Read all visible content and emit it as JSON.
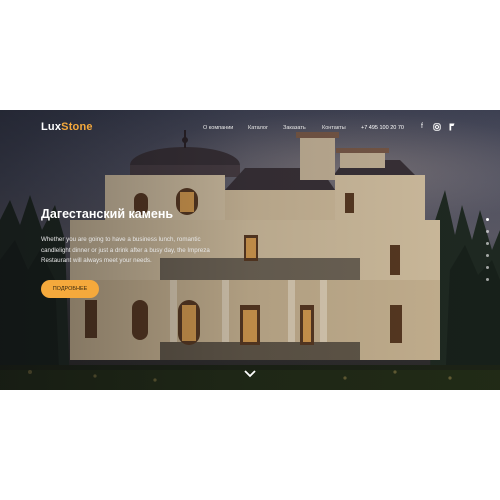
{
  "logo": {
    "part1": "Lux",
    "part2": "Stone"
  },
  "nav": {
    "links": [
      "О компании",
      "Каталог",
      "Заказать",
      "Контакты"
    ],
    "phone": "+7 495 100 20 70"
  },
  "social": {
    "icons": [
      "facebook-icon",
      "instagram-icon",
      "foursquare-icon"
    ],
    "glyphs": [
      "f",
      "◘",
      "ƒ"
    ]
  },
  "hero": {
    "title": "Дагестанский камень",
    "description": "Whether you are going to have a business lunch, romantic candlelight dinner or just a drink after a busy day, the Impreza Restaurant will always meet your needs.",
    "button_label": "ПОДРОБНЕЕ"
  },
  "slider": {
    "count": 6,
    "active_index": 0
  },
  "colors": {
    "accent": "#f5a93c"
  }
}
